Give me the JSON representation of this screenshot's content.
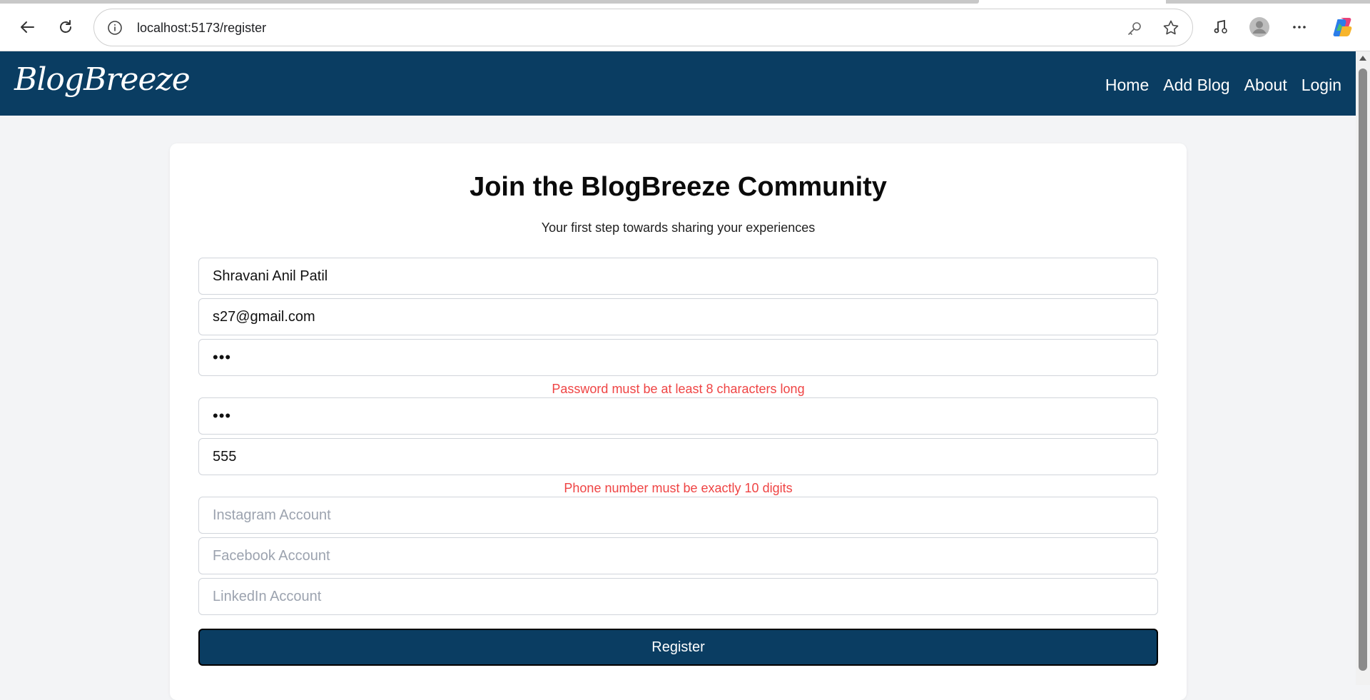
{
  "browser": {
    "url": "localhost:5173/register",
    "icons": [
      "back-icon",
      "reload-icon",
      "info-icon",
      "key-icon",
      "star-icon",
      "media-icon",
      "profile-icon",
      "more-icon",
      "copilot-icon"
    ]
  },
  "nav": {
    "brand": "BlogBreeze",
    "links": [
      "Home",
      "Add Blog",
      "About",
      "Login"
    ],
    "background": "#0a3d62"
  },
  "form": {
    "title": "Join the BlogBreeze Community",
    "subtitle": "Your first step towards sharing your experiences",
    "name_value": "Shravani Anil Patil",
    "email_value": "s27@gmail.com",
    "password_value": "•••",
    "password_error": "Password must be at least 8 characters long",
    "confirm_password_value": "•••",
    "phone_value": "555",
    "phone_error": "Phone number must be exactly 10 digits",
    "instagram_placeholder": "Instagram Account",
    "facebook_placeholder": "Facebook Account",
    "linkedin_placeholder": "LinkedIn Account",
    "submit_label": "Register",
    "error_color": "#ef4444"
  }
}
